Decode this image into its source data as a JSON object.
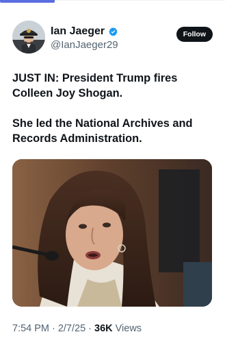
{
  "author": {
    "name": "Ian Jaeger",
    "handle": "@IanJaeger29",
    "verified": true,
    "avatar_icon": "avatar-photo",
    "verified_icon": "verified-badge-icon"
  },
  "follow_label": "Follow",
  "tweet": {
    "paragraphs": [
      "JUST IN: President Trump fires Colleen Joy Shogan.",
      "She led the National Archives and Records Administration."
    ],
    "media_icon": "photo-woman-testifying"
  },
  "meta": {
    "time": "7:54 PM",
    "date": "2/7/25",
    "separator": "·",
    "views_count": "36K",
    "views_label": "Views"
  },
  "colors": {
    "accent": "#1d9bf0",
    "text_primary": "#0f1419",
    "text_secondary": "#536471",
    "follow_bg": "#0f1419",
    "tab_indicator": "#5b6ee1"
  }
}
